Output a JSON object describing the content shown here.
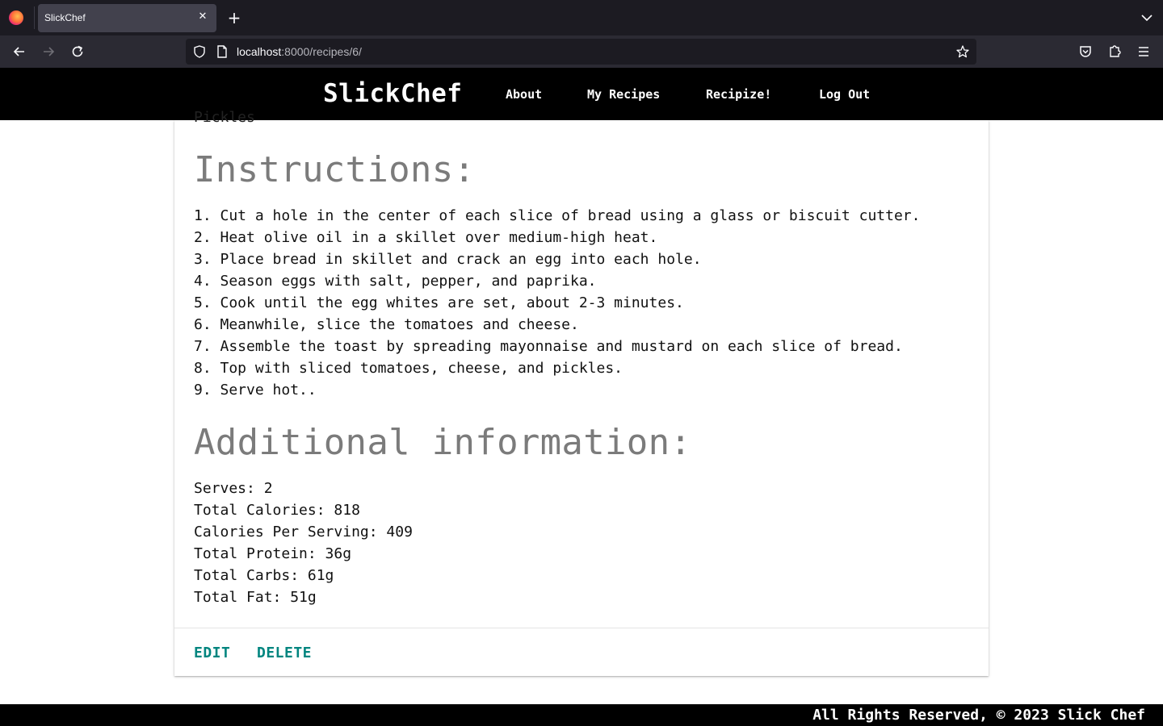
{
  "browser": {
    "tab_title": "SlickChef",
    "url_host": "localhost",
    "url_rest": ":8000/recipes/6/"
  },
  "site": {
    "brand": "SlickChef",
    "nav": [
      "About",
      "My Recipes",
      "Recipize!",
      "Log Out"
    ]
  },
  "recipe": {
    "clipped_ingredient": "Pickles",
    "instructions_heading": "Instructions:",
    "instructions": [
      "1. Cut a hole in the center of each slice of bread using a glass or biscuit cutter.",
      "2. Heat olive oil in a skillet over medium-high heat.",
      "3. Place bread in skillet and crack an egg into each hole.",
      "4. Season eggs with salt, pepper, and paprika.",
      "5. Cook until the egg whites are set, about 2-3 minutes.",
      "6. Meanwhile, slice the tomatoes and cheese.",
      "7. Assemble the toast by spreading mayonnaise and mustard on each slice of bread.",
      "8. Top with sliced tomatoes, cheese, and pickles.",
      "9. Serve hot.."
    ],
    "additional_heading": "Additional information:",
    "additional": [
      "Serves: 2",
      "Total Calories: 818",
      "Calories Per Serving: 409",
      "Total Protein: 36g",
      "Total Carbs: 61g",
      "Total Fat: 51g"
    ],
    "actions": {
      "edit": "EDIT",
      "delete": "DELETE"
    }
  },
  "footer": {
    "text": "All Rights Reserved, © 2023 Slick Chef"
  },
  "colors": {
    "accent": "#00857f",
    "header_bg": "#000000",
    "heading": "#7b7b7b"
  }
}
